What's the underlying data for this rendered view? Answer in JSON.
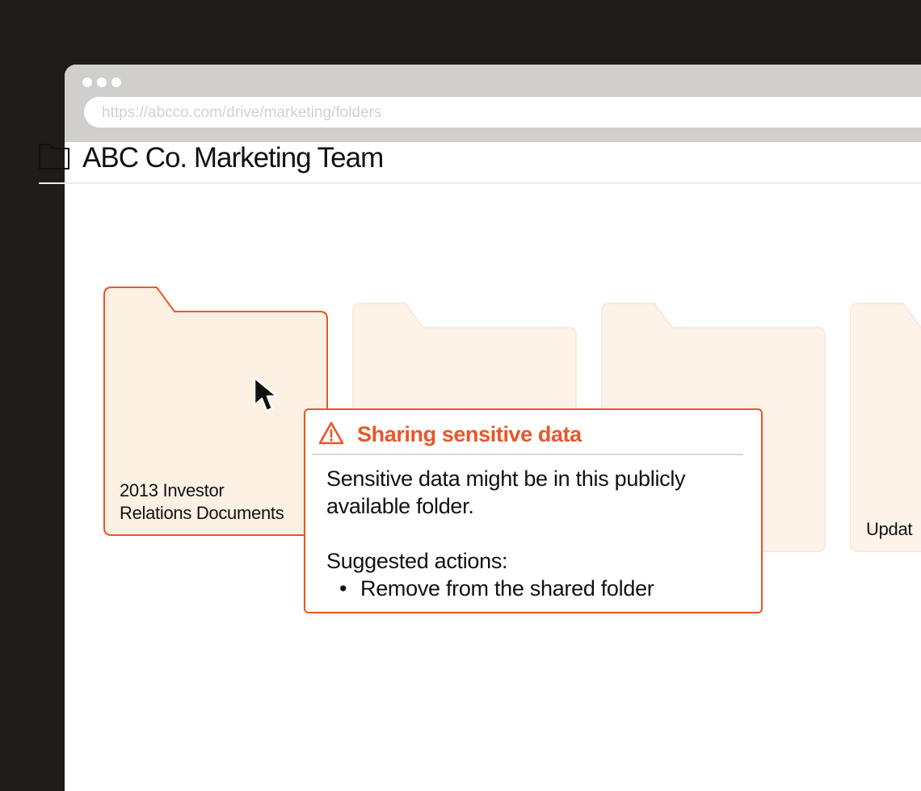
{
  "browser": {
    "url_placeholder": "https://abcco.com/drive/marketing/folders"
  },
  "header": {
    "title": "ABC Co. Marketing Team"
  },
  "folders": [
    {
      "label_line1": "2013 Investor",
      "label_line2": "Relations Documents",
      "state": "selected"
    },
    {
      "label_line1": "",
      "label_line2": "",
      "state": "faded"
    },
    {
      "label_line1": "",
      "label_line2": "",
      "state": "faded"
    },
    {
      "label_line1": "",
      "label_line2": "Updat",
      "state": "faded"
    }
  ],
  "alert": {
    "title": "Sharing sensitive data",
    "message_line1": "Sensitive data might be in this publicly",
    "message_line2": "available folder.",
    "actions_heading": "Suggested actions:",
    "bullet": "•",
    "actions": [
      "Remove from the shared folder"
    ]
  },
  "colors": {
    "accent": "#e8562a",
    "folder_fill": "#fdf1e4",
    "folder_faded_fill": "#fdf3e8",
    "chrome": "#d0cfce",
    "backdrop": "#1e1c1b"
  },
  "icons": {
    "window_controls": "three-dot-icon",
    "header": "folder-outline-icon",
    "alert": "warning-triangle-icon",
    "pointer": "mouse-cursor-icon"
  }
}
